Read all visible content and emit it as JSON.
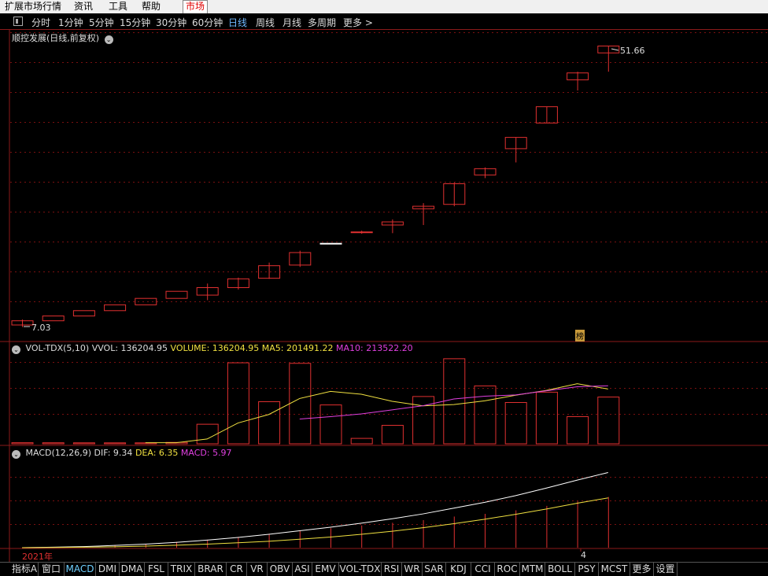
{
  "menu": {
    "items": [
      "扩展市场行情",
      "资讯",
      "工具",
      "帮助"
    ],
    "active_tab": "市场"
  },
  "periods": {
    "items": [
      "分时",
      "1分钟",
      "5分钟",
      "15分钟",
      "30分钟",
      "60分钟",
      "日线",
      "周线",
      "月线",
      "多周期",
      "更多 >"
    ],
    "active": "日线"
  },
  "main_panel": {
    "title": "顺控发展(日线,前复权)",
    "max_label": "51.66",
    "min_label": "7.03",
    "badge": "榜"
  },
  "vol_panel": {
    "name": "VOL-TDX(5,10)",
    "vvol": "VVOL: 136204.95",
    "volume": "VOLUME: 136204.95",
    "ma5": "MA5: 201491.22",
    "ma10": "MA10: 213522.20"
  },
  "macd_panel": {
    "name": "MACD(12,26,9)",
    "dif": "DIF: 9.34",
    "dea": "DEA: 6.35",
    "macd": "MACD: 5.97"
  },
  "axis": {
    "year_label": "2021年",
    "month_label": "4"
  },
  "indicator_tabs": [
    "指标A",
    "窗口",
    "MACD",
    "DMI",
    "DMA",
    "FSL",
    "TRIX",
    "BRAR",
    "CR",
    "VR",
    "OBV",
    "ASI",
    "EMV",
    "VOL-TDX",
    "RSI",
    "WR",
    "SAR",
    "KDJ",
    "CCI",
    "ROC",
    "MTM",
    "BOLL",
    "PSY",
    "MCST",
    "更多",
    "设置"
  ],
  "active_indicator": "MACD",
  "colors": {
    "up": "#e03030",
    "limit_up": "#ffffff",
    "ma5": "#f0e040",
    "ma10": "#e040e0",
    "dif": "#ffffff",
    "dea": "#f0e040",
    "active": "#6fb8ff"
  },
  "chart_data": [
    {
      "type": "candlestick",
      "title": "顺控发展(日线,前复权)",
      "note": "20 trading days; first day through limit-up streak then 10% daily rises",
      "ohlc": [
        [
          7.03,
          7.9,
          6.7,
          7.7
        ],
        [
          7.7,
          8.47,
          8.47,
          8.47
        ],
        [
          8.47,
          9.32,
          9.32,
          9.32
        ],
        [
          9.32,
          10.25,
          10.25,
          10.25
        ],
        [
          10.25,
          11.28,
          11.28,
          11.28
        ],
        [
          11.28,
          12.41,
          12.41,
          12.41
        ],
        [
          11.8,
          13.65,
          11.0,
          13.0
        ],
        [
          13.0,
          14.6,
          12.7,
          14.4
        ],
        [
          14.5,
          17.0,
          14.4,
          16.5
        ],
        [
          16.6,
          18.9,
          16.3,
          18.6
        ],
        [
          20.08,
          20.08,
          20.08,
          20.08
        ],
        [
          21.8,
          22.1,
          21.6,
          21.9
        ],
        [
          23.5,
          23.9,
          21.7,
          23.0
        ],
        [
          26.0,
          26.5,
          23.0,
          25.6
        ],
        [
          26.3,
          29.8,
          26.0,
          29.6
        ],
        [
          32.0,
          32.2,
          30.5,
          31.0
        ],
        [
          35.2,
          37.0,
          33.0,
          37.0
        ],
        [
          39.3,
          41.9,
          39.3,
          41.9
        ],
        [
          46.2,
          47.5,
          44.5,
          47.3
        ],
        [
          50.5,
          51.66,
          47.5,
          51.6
        ]
      ]
    },
    {
      "type": "bar",
      "title": "VOL-TDX(5,10)",
      "values": [
        4000,
        3800,
        3600,
        3500,
        3500,
        5200,
        72000,
        298000,
        155000,
        296000,
        143000,
        20000,
        68000,
        174000,
        313000,
        213000,
        152000,
        190000,
        100000,
        172000,
        136204.95
      ],
      "ma5": [
        null,
        null,
        null,
        null,
        4080,
        3920,
        17560,
        76560,
        107860,
        166600,
        192800,
        182400,
        156400,
        139600,
        144400,
        158000,
        178600,
        196400,
        221000,
        201491.22
      ],
      "ma10": [
        null,
        null,
        null,
        null,
        null,
        null,
        null,
        null,
        null,
        91000,
        100000,
        110000,
        125000,
        140000,
        165000,
        175000,
        180000,
        195000,
        210000,
        213522.2
      ],
      "ylim": [
        0,
        330000
      ]
    },
    {
      "type": "line",
      "title": "MACD(12,26,9)",
      "dif": [
        0.0,
        0.05,
        0.12,
        0.25,
        0.4,
        0.6,
        0.85,
        1.15,
        1.5,
        1.9,
        2.3,
        2.75,
        3.25,
        3.8,
        4.45,
        5.1,
        5.85,
        6.7,
        7.6,
        8.45,
        9.34
      ],
      "dea": [
        0.0,
        0.02,
        0.05,
        0.1,
        0.18,
        0.28,
        0.4,
        0.55,
        0.72,
        0.95,
        1.2,
        1.5,
        1.85,
        2.25,
        2.7,
        3.2,
        3.75,
        4.35,
        5.0,
        5.6,
        6.35
      ],
      "macd": [
        0.0,
        0.06,
        0.14,
        0.3,
        0.44,
        0.64,
        0.9,
        1.2,
        1.56,
        1.9,
        2.2,
        2.5,
        2.8,
        3.1,
        3.5,
        3.8,
        4.2,
        4.7,
        5.2,
        5.7,
        5.97
      ],
      "ylim": [
        0,
        10
      ]
    }
  ]
}
